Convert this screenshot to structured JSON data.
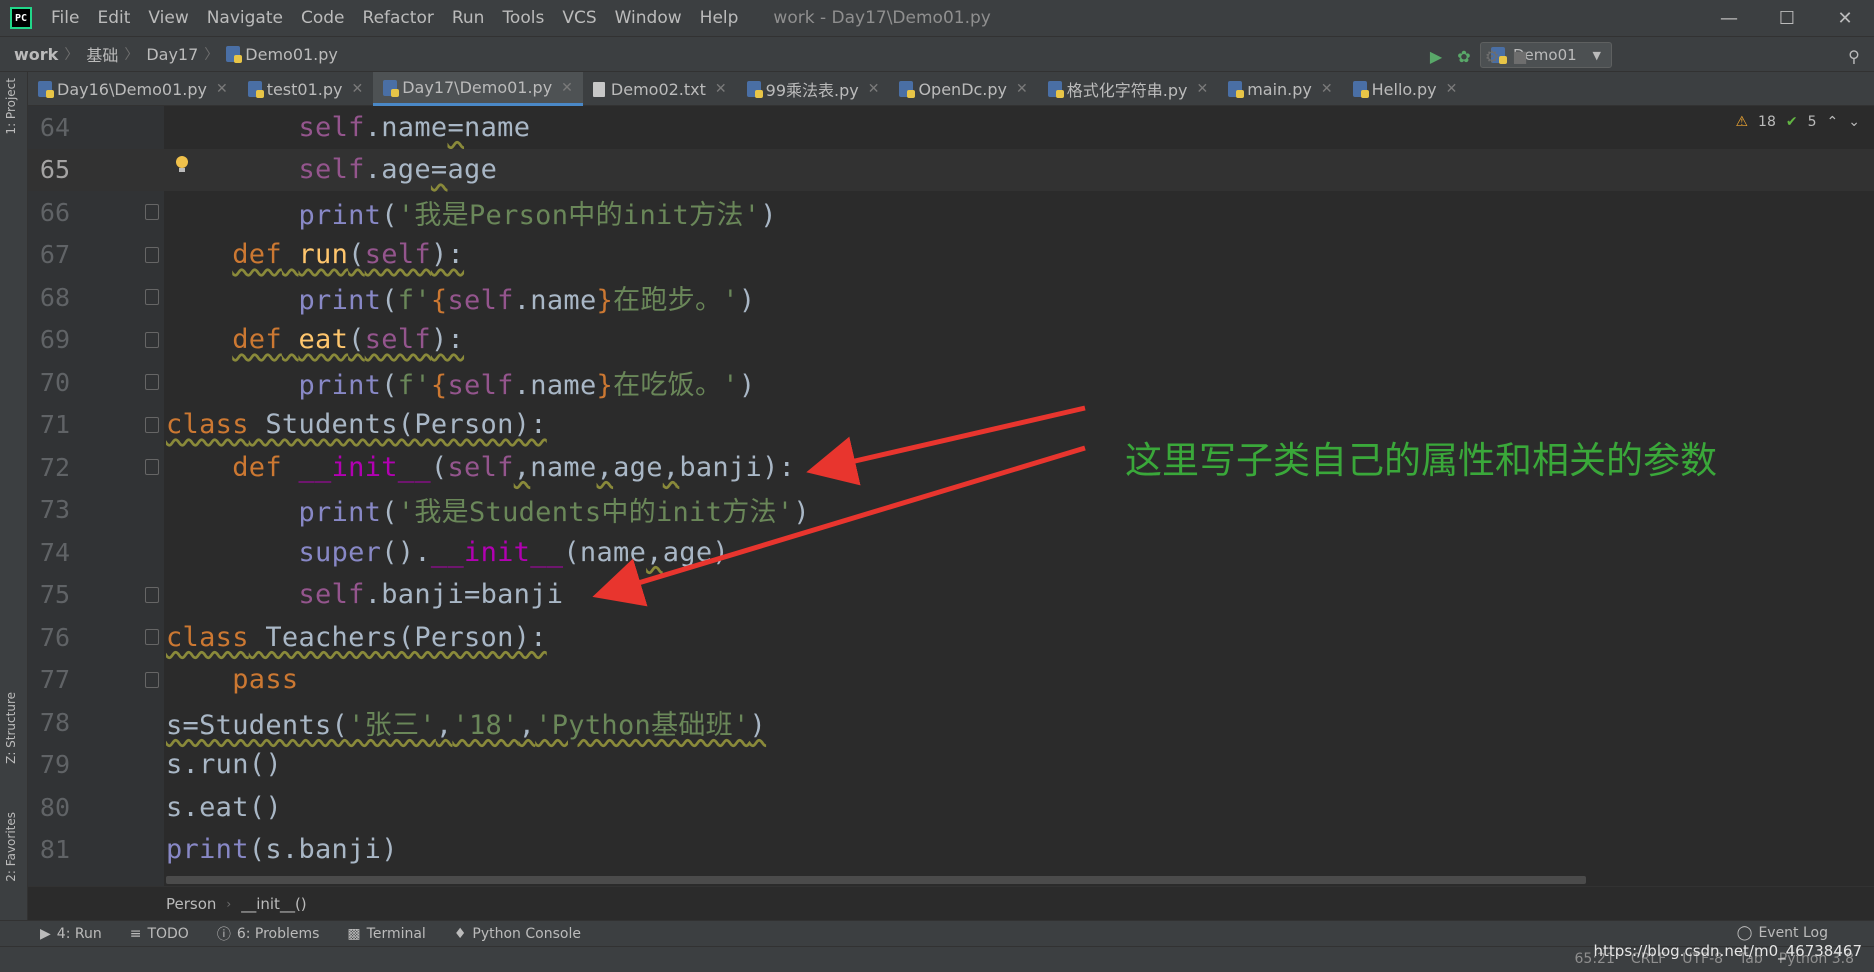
{
  "titlebar": {
    "menu": [
      "File",
      "Edit",
      "View",
      "Navigate",
      "Code",
      "Refactor",
      "Run",
      "Tools",
      "VCS",
      "Window",
      "Help"
    ],
    "window_title": "work - Day17\\Demo01.py"
  },
  "navbar": {
    "crumbs": [
      "work",
      "基础",
      "Day17",
      "Demo01.py"
    ],
    "run_config": "Demo01"
  },
  "tabs": [
    {
      "label": "Day16\\Demo01.py"
    },
    {
      "label": "test01.py"
    },
    {
      "label": "Day17\\Demo01.py"
    },
    {
      "label": "Demo02.txt"
    },
    {
      "label": "99乘法表.py"
    },
    {
      "label": "OpenDc.py"
    },
    {
      "label": "格式化字符串.py"
    },
    {
      "label": "main.py"
    },
    {
      "label": "Hello.py"
    }
  ],
  "left_strip": {
    "project": "1: Project",
    "structure": "Z: Structure",
    "favorites": "2: Favorites"
  },
  "inspection": {
    "warnings": "18",
    "weak": "5"
  },
  "lines": [
    "64",
    "65",
    "66",
    "67",
    "68",
    "69",
    "70",
    "71",
    "72",
    "73",
    "74",
    "75",
    "76",
    "77",
    "78",
    "79",
    "80",
    "81"
  ],
  "annotation": "这里写子类自己的属性和相关的参数",
  "structure_path": [
    "Person",
    "__init__()"
  ],
  "bottom_tools": [
    "4: Run",
    "TODO",
    "6: Problems",
    "Terminal",
    "Python Console"
  ],
  "event_log": "Event Log",
  "status": {
    "position": "65:21",
    "line_sep": "CRLF",
    "encoding": "UTF-8",
    "indent": "Tab",
    "interpreter": "Python 3.8"
  },
  "watermark": "https://blog.csdn.net/m0_46738467"
}
